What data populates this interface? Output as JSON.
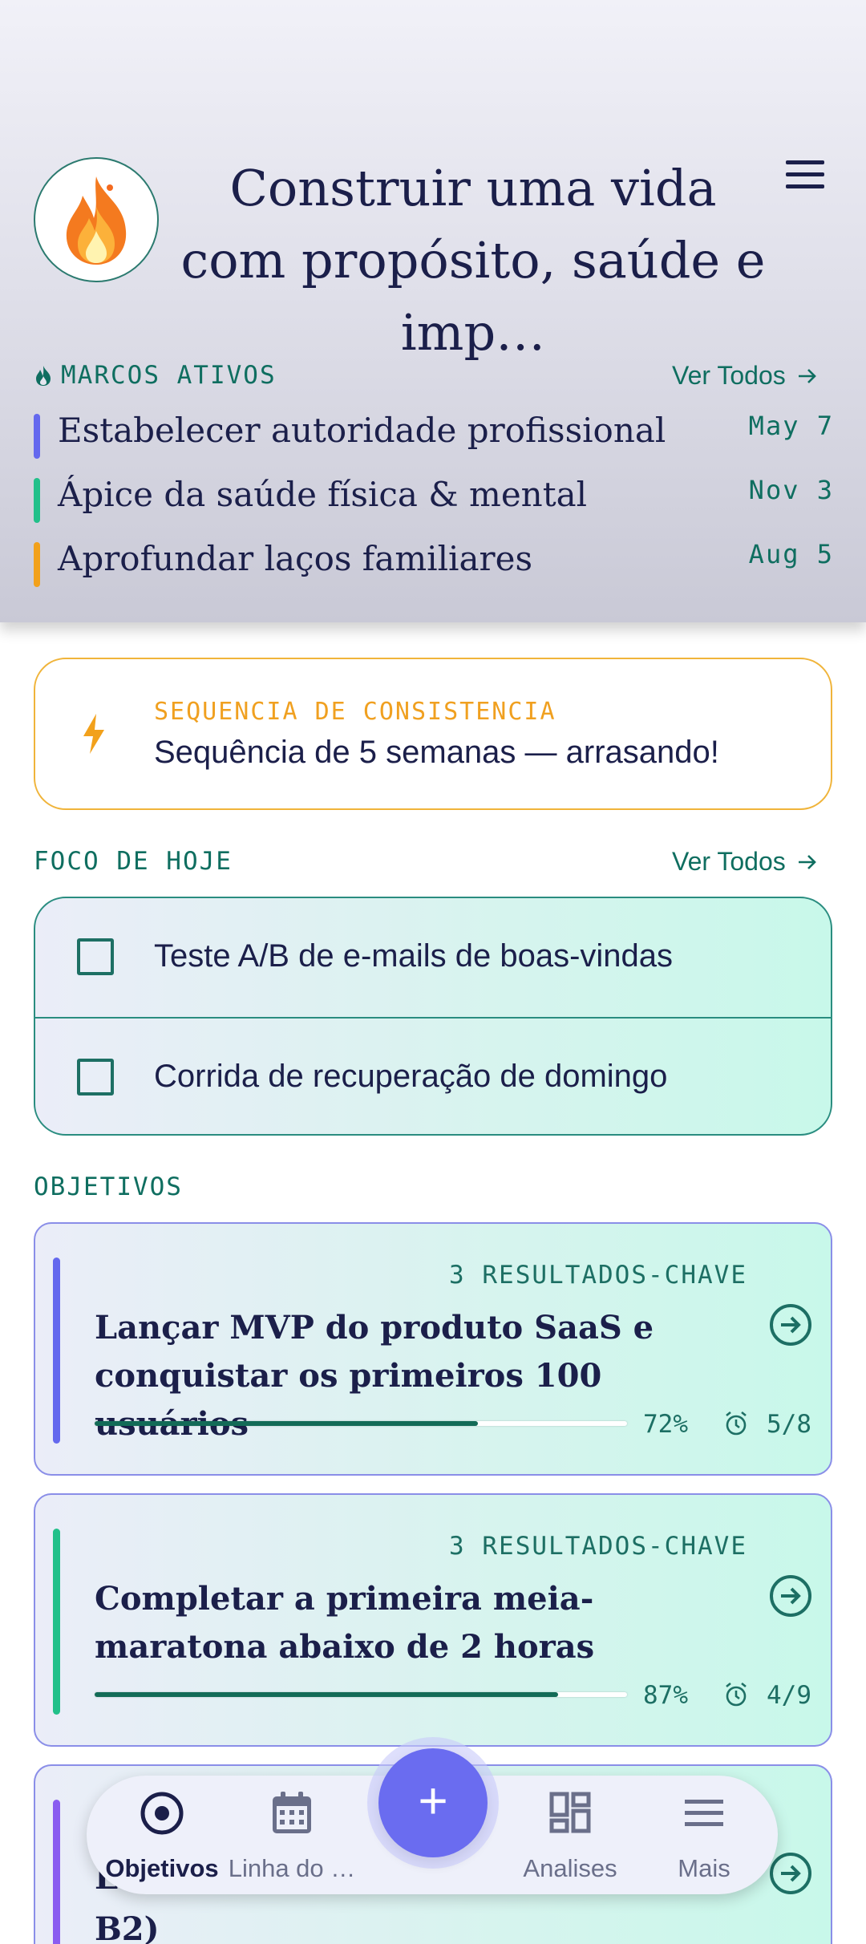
{
  "header": {
    "title": "Construir uma vida com propósito, saúde e imp…",
    "avatar_icon": "fire-icon",
    "menu_icon": "hamburger-menu-icon"
  },
  "milestones": {
    "label": "MARCOS ATIVOS",
    "see_all": "Ver Todos",
    "items": [
      {
        "name": "Estabelecer autoridade profissional",
        "date": "May 7",
        "color": "#6468ee"
      },
      {
        "name": "Ápice da saúde física & mental",
        "date": "Nov 3",
        "color": "#22c08a"
      },
      {
        "name": "Aprofundar laços familiares",
        "date": "Aug 5",
        "color": "#f2a11b"
      }
    ]
  },
  "streak": {
    "label": "SEQUENCIA DE CONSISTENCIA",
    "message": "Sequência de 5 semanas — arrasando!"
  },
  "focus": {
    "label": "FOCO DE HOJE",
    "see_all": "Ver Todos",
    "tasks": [
      {
        "text": "Teste A/B de e-mails de boas-vindas"
      },
      {
        "text": "Corrida de recuperação de domingo"
      }
    ]
  },
  "objectives": {
    "label": "OBJETIVOS",
    "items": [
      {
        "key_results": "3 RESULTADOS-CHAVE",
        "title": "Lançar MVP do produto SaaS e conquistar os primeiros 100 usuários",
        "progress": 72,
        "progress_label": "72%",
        "count": "5/8",
        "color": "#6468ee"
      },
      {
        "key_results": "3 RESULTADOS-CHAVE",
        "title": "Completar a primeira meia-maratona abaixo de 2 horas",
        "progress": 87,
        "progress_label": "87%",
        "count": "4/9",
        "color": "#22c08a"
      },
      {
        "title_partial_first": "E",
        "title_partial_last": "B2)",
        "color": "#8a5cf0"
      }
    ]
  },
  "nav": {
    "items": [
      {
        "label": "Objetivos",
        "icon": "target-icon",
        "active": true
      },
      {
        "label": "Linha do …",
        "icon": "calendar-icon",
        "active": false
      },
      {
        "label": "Analises",
        "icon": "dashboard-icon",
        "active": false
      },
      {
        "label": "Mais",
        "icon": "menu-icon",
        "active": false
      }
    ],
    "fab_label": "+"
  }
}
